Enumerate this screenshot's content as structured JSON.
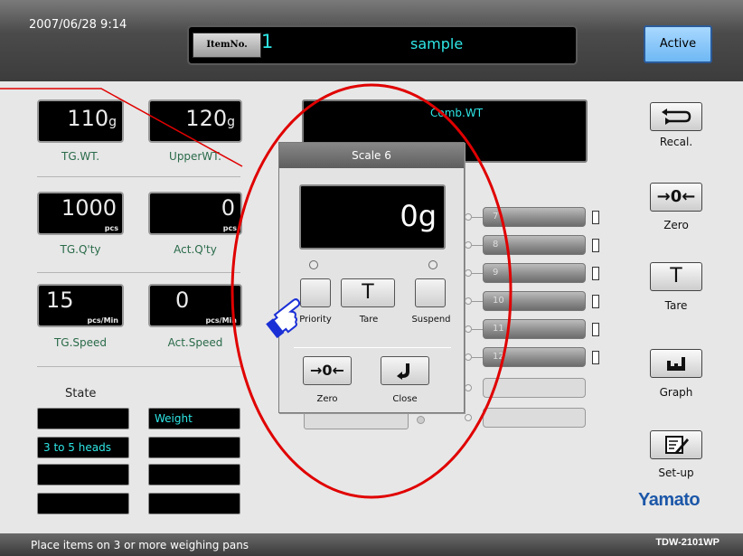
{
  "header": {
    "datetime": "2007/06/28  9:14",
    "item_no_label": "ItemNo.",
    "item_no": "1",
    "item_name": "sample",
    "active_label": "Active"
  },
  "left": {
    "tg_wt": {
      "value": "110",
      "unit": "g",
      "label": "TG.WT."
    },
    "upper_wt": {
      "value": "120",
      "unit": "g",
      "label": "UpperWT."
    },
    "tg_qty": {
      "value": "1000",
      "unit": "pcs",
      "label": "TG.Q'ty"
    },
    "act_qty": {
      "value": "0",
      "unit": "pcs",
      "label": "Act.Q'ty"
    },
    "tg_speed": {
      "value": "15",
      "unit": "pcs/Min",
      "label": "TG.Speed"
    },
    "act_speed": {
      "value": "0",
      "unit": "pcs/Min",
      "label": "Act.Speed"
    },
    "state_title": "State",
    "state_boxes": [
      "",
      "Weight",
      "3 to 5 heads",
      "",
      "",
      "",
      "",
      ""
    ]
  },
  "center": {
    "comb_wt_label": "Comb.WT",
    "pans": [
      "7",
      "8",
      "9",
      "10",
      "11",
      "12"
    ]
  },
  "dialog": {
    "title": "Scale 6",
    "weight": "0g",
    "priority_label": "Priority",
    "tare_label": "Tare",
    "suspend_label": "Suspend",
    "tare_glyph": "T",
    "zero_glyph": "→0←",
    "zero_label": "Zero",
    "close_label": "Close"
  },
  "right": {
    "recal_label": "Recal.",
    "zero_label": "Zero",
    "zero_glyph": "→0←",
    "tare_label": "Tare",
    "tare_glyph": "T",
    "graph_label": "Graph",
    "setup_label": "Set-up",
    "brand": "Yamato"
  },
  "footer": {
    "message": "Place items on 3 or more weighing pans",
    "model": "TDW-2101WP"
  },
  "colors": {
    "header_bg": "#4b4b4b",
    "display_text": "#2fe6e6",
    "active_btn": "#6fb8f4",
    "highlight_circle": "#e00000",
    "brand": "#1c57a8",
    "pointer_hand": "#1a2fd6"
  },
  "icons": [
    "recal-icon",
    "zero-icon",
    "tare-icon",
    "graph-icon",
    "setup-icon",
    "close-arrow-icon",
    "hand-pointer-icon"
  ]
}
